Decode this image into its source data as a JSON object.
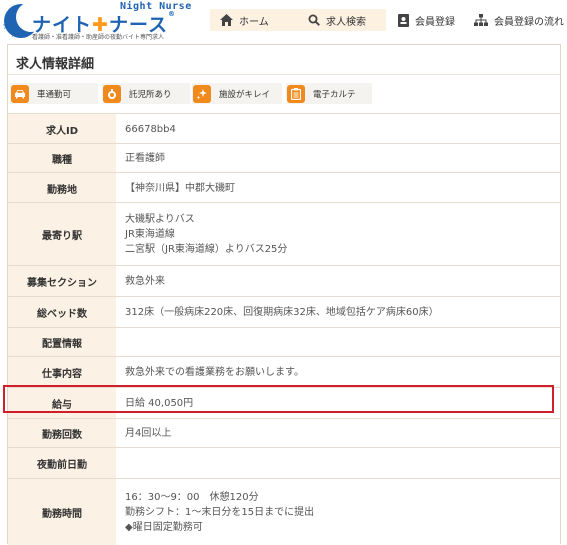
{
  "header": {
    "logo_en": "Night Nurse",
    "logo_title_main": "ナイト",
    "logo_title_plus": "✚",
    "logo_title_tail": "ナース",
    "logo_reg": "®",
    "logo_tagline": "看護師・准看護師・助産師の夜勤バイト専門求人",
    "brand_color": "#1f63b3",
    "accent_color": "#ff9a1a"
  },
  "nav": {
    "home": "ホーム",
    "search": "求人検索",
    "register": "会員登録",
    "flow": "会員登録の流れ"
  },
  "panel": {
    "title": "求人情報詳細"
  },
  "tags": [
    {
      "label": "車通勤可",
      "icon": "car-icon"
    },
    {
      "label": "託児所あり",
      "icon": "baby-bottle-icon"
    },
    {
      "label": "施設がキレイ",
      "icon": "sparkle-icon"
    },
    {
      "label": "電子カルテ",
      "icon": "clipboard-icon"
    }
  ],
  "details": {
    "job_id_label": "求人ID",
    "job_id": "66678bb4",
    "occupation_label": "職種",
    "occupation": "正看護師",
    "location_label": "勤務地",
    "location": "【神奈川県】中郡大磯町",
    "station_label": "最寄り駅",
    "station_1": "大磯駅よりバス",
    "station_2": "JR東海道線",
    "station_3": "二宮駅（JR東海道線）よりバス25分",
    "section_label": "募集セクション",
    "section": "救急外来",
    "beds_label": "総ベッド数",
    "beds": "312床（一般病床220床、回復期病床32床、地域包括ケア病床60床）",
    "assignment_label": "配置情報",
    "assignment": "",
    "work_label": "仕事内容",
    "work": "救急外来での看護業務をお願いします。",
    "salary_label": "給与",
    "salary": "日給 40,050円",
    "frequency_label": "勤務回数",
    "frequency": "月4回以上",
    "pre_night_label": "夜勤前日勤",
    "pre_night": "",
    "hours_label": "勤務時間",
    "hours_1": "16：30～9：00　休憩120分",
    "hours_2": "勤務シフト：1～末日分を15日までに提出",
    "hours_3": "◆曜日固定勤務可"
  },
  "colors": {
    "label_bg": "#fbf1e4",
    "tag_icon_bg": "#f08a1c",
    "highlight_border": "#d21e2a"
  }
}
